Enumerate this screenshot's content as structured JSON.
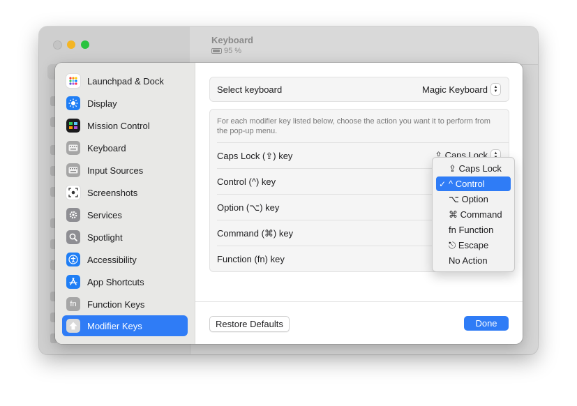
{
  "window": {
    "title": "Keyboard",
    "battery": "95 %"
  },
  "sidebar": {
    "items": [
      {
        "label": "Launchpad & Dock",
        "icon": "launchpad-icon",
        "color": "#ffffff",
        "selected": false
      },
      {
        "label": "Display",
        "icon": "display-icon",
        "color": "#1f7ef5",
        "selected": false
      },
      {
        "label": "Mission Control",
        "icon": "mission-control-icon",
        "color": "#1c1c1e",
        "selected": false
      },
      {
        "label": "Keyboard",
        "icon": "keyboard-icon",
        "color": "#9a9a9a",
        "selected": false
      },
      {
        "label": "Input Sources",
        "icon": "keyboard-icon",
        "color": "#9a9a9a",
        "selected": false
      },
      {
        "label": "Screenshots",
        "icon": "screenshot-icon",
        "color": "#ffffff",
        "selected": false
      },
      {
        "label": "Services",
        "icon": "gear-icon",
        "color": "#8e8e93",
        "selected": false
      },
      {
        "label": "Spotlight",
        "icon": "spotlight-icon",
        "color": "#8e8e93",
        "selected": false
      },
      {
        "label": "Accessibility",
        "icon": "accessibility-icon",
        "color": "#1f7ef5",
        "selected": false
      },
      {
        "label": "App Shortcuts",
        "icon": "app-store-icon",
        "color": "#1f7ef5",
        "selected": false
      },
      {
        "label": "Function Keys",
        "icon": "fn-icon",
        "color": "#9a9a9a",
        "selected": false
      },
      {
        "label": "Modifier Keys",
        "icon": "arrow-up-icon",
        "color": "#9a9a9a",
        "selected": true
      }
    ],
    "selected_color": "#2f7cf6"
  },
  "select_keyboard": {
    "label": "Select keyboard",
    "value": "Magic Keyboard"
  },
  "modifier": {
    "description": "For each modifier key listed below, choose the action you want it to perform from the pop-up menu.",
    "rows": [
      {
        "label": "Caps Lock (⇪) key",
        "value": "⇪ Caps Lock"
      },
      {
        "label": "Control (^) key",
        "value": ""
      },
      {
        "label": "Option (⌥) key",
        "value": ""
      },
      {
        "label": "Command (⌘) key",
        "value": ""
      },
      {
        "label": "Function (fn) key",
        "value": ""
      }
    ]
  },
  "footer": {
    "restore_label": "Restore Defaults",
    "done_label": "Done"
  },
  "menu": {
    "items": [
      {
        "label": "⇪ Caps Lock",
        "checked": false,
        "highlighted": false
      },
      {
        "label": "^ Control",
        "checked": true,
        "highlighted": true
      },
      {
        "label": "⌥ Option",
        "checked": false,
        "highlighted": false
      },
      {
        "label": "⌘ Command",
        "checked": false,
        "highlighted": false
      },
      {
        "label": "fn Function",
        "checked": false,
        "highlighted": false
      },
      {
        "label": "⎋ Escape",
        "checked": false,
        "highlighted": false
      },
      {
        "label": "No Action",
        "checked": false,
        "highlighted": false
      }
    ],
    "check_glyph": "✓"
  }
}
